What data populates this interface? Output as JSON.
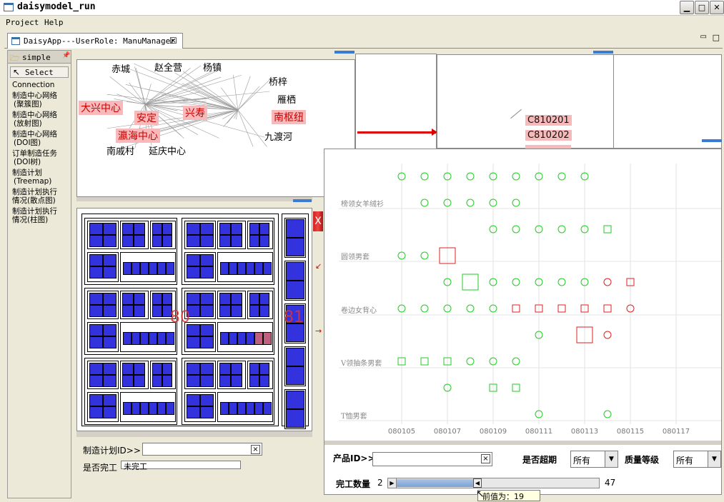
{
  "window": {
    "title": "daisymodel_run",
    "controls": [
      "_",
      "□",
      "×"
    ]
  },
  "menu": {
    "items": [
      "Project",
      "Help"
    ]
  },
  "editor_tab": {
    "label": "DaisyApp---UserRole: ManuManager"
  },
  "palette": {
    "header": "simple",
    "select": "Select",
    "items": [
      "Connection",
      "制造中心网络",
      "(聚簇图)",
      "制造中心网络",
      "(放射图)",
      "制造中心网络",
      "(DOI图)",
      "订单制造任务",
      "(DOI树)",
      "制造计划",
      "(Treemap)",
      "制造计划执行",
      "情况(散点图)",
      "制造计划执行",
      "情况(柱图)"
    ]
  },
  "network": {
    "highlight_labels": [
      "大兴中心",
      "安定",
      "瀛海中心",
      "兴寿",
      "南枢纽"
    ],
    "plain_labels": [
      "桥梓",
      "雁栖",
      "九渡河",
      "南戚村",
      "延庆中心",
      "赵全营",
      "赤城",
      "杨镇"
    ]
  },
  "doi": {
    "labels": [
      "C810201",
      "C810202"
    ]
  },
  "treemap": {
    "labels": [
      "80",
      "81"
    ]
  },
  "plan_panel": {
    "search_label": "制造计划ID>>",
    "search_value": "",
    "status_label": "是否完工",
    "status_value": "未完工"
  },
  "scatter": {
    "y_labels": [
      "榜领女羊绒衫",
      "圆领男套",
      "卷边女背心",
      "V领抽条男套",
      "T恤男套"
    ],
    "x_labels": [
      "080105",
      "080107",
      "080109",
      "080111",
      "080113",
      "080115",
      "080117"
    ]
  },
  "chart_data": {
    "type": "scatter",
    "xlabel": "",
    "ylabel": "",
    "x_ticks": [
      "080105",
      "080107",
      "080109",
      "080111",
      "080113",
      "080115",
      "080117"
    ],
    "y_categories": [
      "榜领女羊绒衫",
      "圆领男套",
      "卷边女背心",
      "V领抽条男套",
      "T恤男套"
    ],
    "points": [
      {
        "x": 0,
        "y": 0,
        "s": "circle",
        "c": "g"
      },
      {
        "x": 1,
        "y": 0,
        "s": "circle",
        "c": "g"
      },
      {
        "x": 2,
        "y": 0,
        "s": "circle",
        "c": "g"
      },
      {
        "x": 3,
        "y": 0,
        "s": "circle",
        "c": "g"
      },
      {
        "x": 4,
        "y": 0,
        "s": "circle",
        "c": "g"
      },
      {
        "x": 5,
        "y": 0,
        "s": "circle",
        "c": "g"
      },
      {
        "x": 6,
        "y": 0,
        "s": "circle",
        "c": "g"
      },
      {
        "x": 7,
        "y": 0,
        "s": "circle",
        "c": "g"
      },
      {
        "x": 8,
        "y": 0,
        "s": "circle",
        "c": "g"
      },
      {
        "x": 1,
        "y": 1,
        "s": "circle",
        "c": "g"
      },
      {
        "x": 2,
        "y": 1,
        "s": "circle",
        "c": "g"
      },
      {
        "x": 3,
        "y": 1,
        "s": "circle",
        "c": "g"
      },
      {
        "x": 4,
        "y": 1,
        "s": "circle",
        "c": "g"
      },
      {
        "x": 5,
        "y": 1,
        "s": "circle",
        "c": "g"
      },
      {
        "x": 4,
        "y": 2,
        "s": "circle",
        "c": "g"
      },
      {
        "x": 5,
        "y": 2,
        "s": "circle",
        "c": "g"
      },
      {
        "x": 6,
        "y": 2,
        "s": "circle",
        "c": "g"
      },
      {
        "x": 7,
        "y": 2,
        "s": "circle",
        "c": "g"
      },
      {
        "x": 8,
        "y": 2,
        "s": "circle",
        "c": "g"
      },
      {
        "x": 9,
        "y": 2,
        "s": "square",
        "c": "g"
      },
      {
        "x": 0,
        "y": 3,
        "s": "circle",
        "c": "g"
      },
      {
        "x": 1,
        "y": 3,
        "s": "circle",
        "c": "g"
      },
      {
        "x": 2,
        "y": 3,
        "s": "bigsquare",
        "c": "r"
      },
      {
        "x": 2,
        "y": 4,
        "s": "circle",
        "c": "g"
      },
      {
        "x": 3,
        "y": 4,
        "s": "bigsquare",
        "c": "g"
      },
      {
        "x": 4,
        "y": 4,
        "s": "circle",
        "c": "g"
      },
      {
        "x": 5,
        "y": 4,
        "s": "circle",
        "c": "g"
      },
      {
        "x": 6,
        "y": 4,
        "s": "circle",
        "c": "g"
      },
      {
        "x": 7,
        "y": 4,
        "s": "circle",
        "c": "g"
      },
      {
        "x": 8,
        "y": 4,
        "s": "circle",
        "c": "g"
      },
      {
        "x": 9,
        "y": 4,
        "s": "circle",
        "c": "r"
      },
      {
        "x": 10,
        "y": 4,
        "s": "square",
        "c": "r"
      },
      {
        "x": 0,
        "y": 5,
        "s": "circle",
        "c": "g"
      },
      {
        "x": 1,
        "y": 5,
        "s": "circle",
        "c": "g"
      },
      {
        "x": 2,
        "y": 5,
        "s": "circle",
        "c": "g"
      },
      {
        "x": 3,
        "y": 5,
        "s": "circle",
        "c": "g"
      },
      {
        "x": 4,
        "y": 5,
        "s": "circle",
        "c": "g"
      },
      {
        "x": 5,
        "y": 5,
        "s": "square",
        "c": "r"
      },
      {
        "x": 6,
        "y": 5,
        "s": "square",
        "c": "r"
      },
      {
        "x": 7,
        "y": 5,
        "s": "square",
        "c": "r"
      },
      {
        "x": 8,
        "y": 5,
        "s": "square",
        "c": "r"
      },
      {
        "x": 9,
        "y": 5,
        "s": "square",
        "c": "r"
      },
      {
        "x": 10,
        "y": 5,
        "s": "circle",
        "c": "r"
      },
      {
        "x": 6,
        "y": 6,
        "s": "circle",
        "c": "g"
      },
      {
        "x": 8,
        "y": 6,
        "s": "bigsquare",
        "c": "r"
      },
      {
        "x": 9,
        "y": 6,
        "s": "circle",
        "c": "r"
      },
      {
        "x": 0,
        "y": 7,
        "s": "square",
        "c": "g"
      },
      {
        "x": 1,
        "y": 7,
        "s": "square",
        "c": "g"
      },
      {
        "x": 2,
        "y": 7,
        "s": "square",
        "c": "g"
      },
      {
        "x": 3,
        "y": 7,
        "s": "circle",
        "c": "g"
      },
      {
        "x": 4,
        "y": 7,
        "s": "circle",
        "c": "g"
      },
      {
        "x": 5,
        "y": 7,
        "s": "circle",
        "c": "g"
      },
      {
        "x": 2,
        "y": 8,
        "s": "circle",
        "c": "g"
      },
      {
        "x": 4,
        "y": 8,
        "s": "square",
        "c": "g"
      },
      {
        "x": 5,
        "y": 8,
        "s": "square",
        "c": "g"
      },
      {
        "x": 6,
        "y": 9,
        "s": "circle",
        "c": "g"
      },
      {
        "x": 9,
        "y": 9,
        "s": "circle",
        "c": "g"
      }
    ]
  },
  "controls": {
    "product_label": "产品ID>>",
    "product_value": "",
    "overdue_label": "是否超期",
    "overdue_value": "所有",
    "quality_label": "质量等级",
    "quality_value": "所有",
    "count_label": "完工数量",
    "slider_min": "2",
    "slider_max": "47",
    "slider_value": 19,
    "tooltip": "前值为：19"
  },
  "colors": {
    "green": "#22cc22",
    "red": "#dd2222",
    "treemap_blue": "#3333dd",
    "treemap_pink": "#c06080"
  }
}
